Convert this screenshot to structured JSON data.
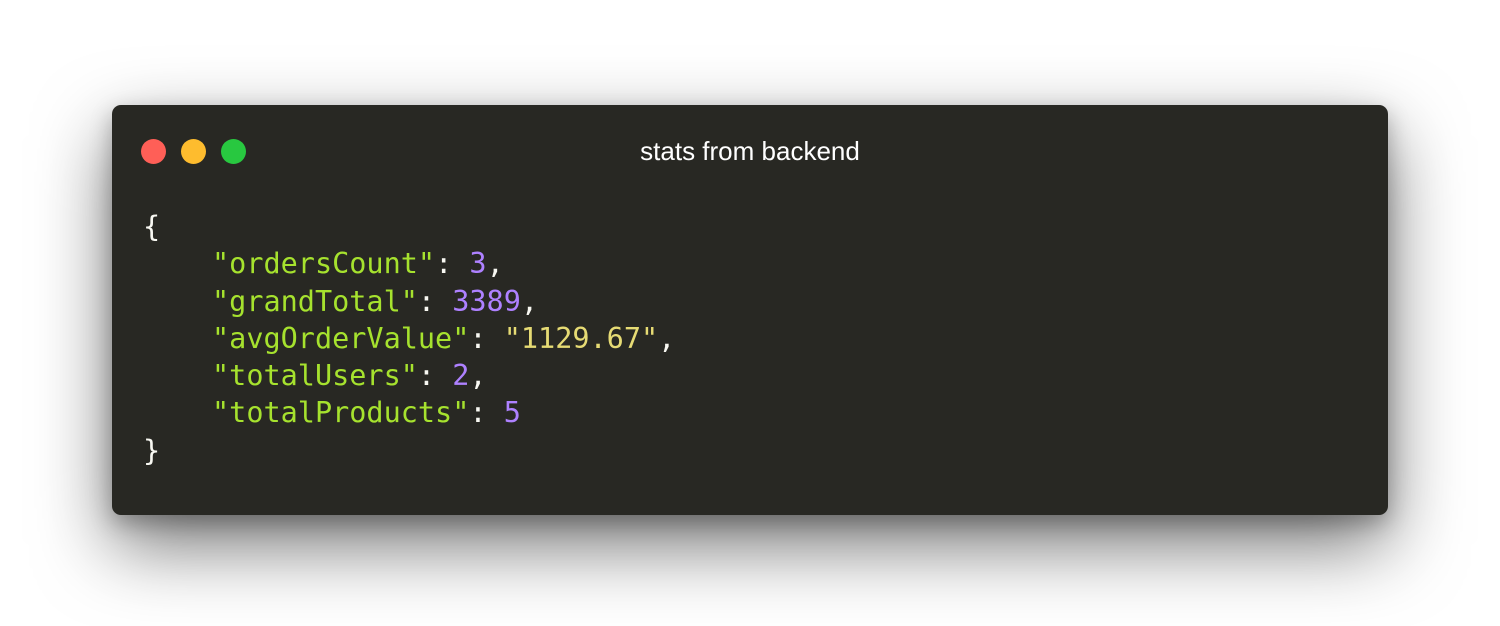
{
  "window": {
    "title": "stats from backend",
    "buttons": {
      "close_color": "#ff5f57",
      "minimize_color": "#febc2e",
      "maximize_color": "#28c840"
    }
  },
  "code": {
    "open_brace": "{",
    "close_brace": "}",
    "colon": ": ",
    "comma": ",",
    "lines": [
      {
        "key": "\"ordersCount\"",
        "value": "3",
        "value_type": "number",
        "trailing_comma": true
      },
      {
        "key": "\"grandTotal\"",
        "value": "3389",
        "value_type": "number",
        "trailing_comma": true
      },
      {
        "key": "\"avgOrderValue\"",
        "value": "\"1129.67\"",
        "value_type": "string",
        "trailing_comma": true
      },
      {
        "key": "\"totalUsers\"",
        "value": "2",
        "value_type": "number",
        "trailing_comma": true
      },
      {
        "key": "\"totalProducts\"",
        "value": "5",
        "value_type": "number",
        "trailing_comma": false
      }
    ]
  },
  "colors": {
    "window_background": "#282823",
    "key": "#a6e22e",
    "number": "#ae81ff",
    "string": "#e6db74",
    "punctuation": "#f8f8f2"
  }
}
